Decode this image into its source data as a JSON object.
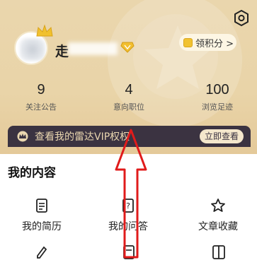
{
  "header": {
    "username_visible": "走",
    "points_label": "领积分 >"
  },
  "stats": [
    {
      "value": "9",
      "label": "关注公告"
    },
    {
      "value": "4",
      "label": "意向职位"
    },
    {
      "value": "100",
      "label": "浏览足迹"
    }
  ],
  "vip_banner": {
    "text": "查看我的雷达VIP权权",
    "button": "立即查看"
  },
  "section": {
    "title": "我的内容",
    "items": [
      {
        "label": "我的简历",
        "icon": "resume-icon"
      },
      {
        "label": "我的问答",
        "icon": "qa-icon"
      },
      {
        "label": "文章收藏",
        "icon": "star-icon"
      }
    ]
  },
  "colors": {
    "header_bg": "#e9d4a8",
    "banner_bg": "#3b3341",
    "accent": "#ead7b0",
    "arrow": "#e01b1b"
  }
}
